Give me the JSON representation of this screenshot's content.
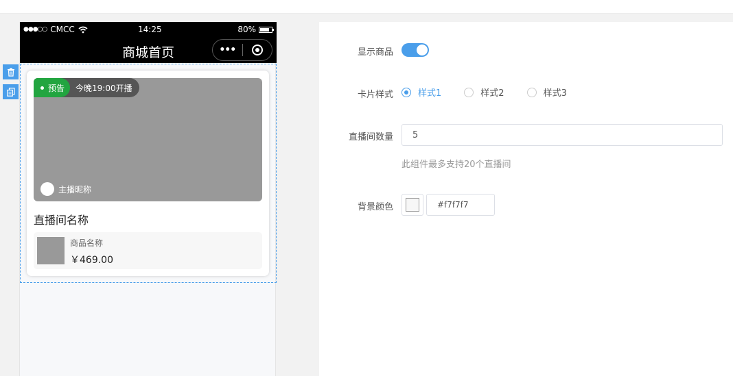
{
  "status_bar": {
    "signal": "●●●○○",
    "carrier": "CMCC",
    "wifi_icon": "wifi-icon",
    "time": "14:25",
    "battery": "80%",
    "battery_level": 0.8
  },
  "navbar": {
    "title": "商城首页",
    "more_icon": "more-dots-icon",
    "close_icon": "target-circle-icon"
  },
  "tools": [
    {
      "icon": "trash-icon"
    },
    {
      "icon": "copy-icon"
    }
  ],
  "live_card": {
    "tag": "预告",
    "start_time": "今晚19:00开播",
    "anchor_name": "主播昵称",
    "room_name": "直播间名称",
    "goods_name": "商品名称",
    "goods_price": "￥469.00"
  },
  "settings": {
    "show_goods_label": "显示商品",
    "show_goods_on": true,
    "card_style_label": "卡片样式",
    "card_styles": [
      "样式1",
      "样式2",
      "样式3"
    ],
    "selected_style": "样式1",
    "room_count_label": "直播间数量",
    "room_count_value": "5",
    "room_count_hint": "此组件最多支持20个直播间",
    "bg_color_label": "背景颜色",
    "bg_color_value": "#f7f7f7"
  },
  "colors": {
    "accent": "#4a9eea",
    "tag_green": "#22a540",
    "placeholder_gray": "#999999"
  }
}
